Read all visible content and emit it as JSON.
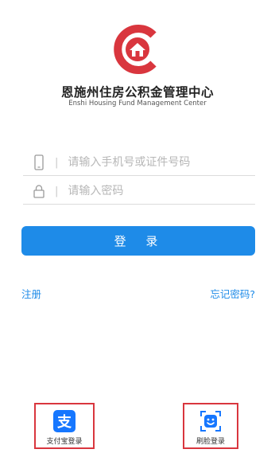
{
  "org": {
    "name_cn": "恩施州住房公积金管理中心",
    "name_en": "Enshi Housing Fund Management Center"
  },
  "form": {
    "phone_placeholder": "请输入手机号或证件号码",
    "password_placeholder": "请输入密码",
    "login_label": "登 录"
  },
  "links": {
    "register": "注册",
    "forgot": "忘记密码?"
  },
  "alt_login": {
    "alipay_label": "支付宝登录",
    "face_label": "刷脸登录"
  },
  "icons": {
    "logo": "house-logo-icon",
    "phone": "phone-icon",
    "lock": "lock-icon",
    "alipay": "alipay-icon",
    "face": "face-scan-icon"
  },
  "colors": {
    "brand_red": "#d9363e",
    "primary_blue": "#1e8be8",
    "alipay_blue": "#1677ff"
  }
}
